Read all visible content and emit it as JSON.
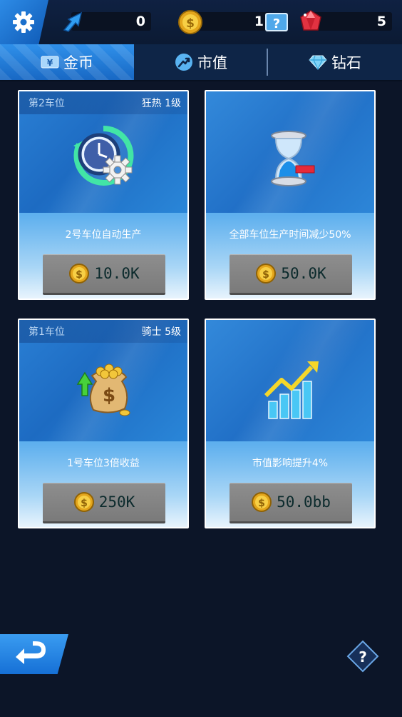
{
  "resources": {
    "shares": "0",
    "coins": "1",
    "gems": "5"
  },
  "tabs": [
    {
      "label": "金币",
      "icon": "coin-ticket-icon",
      "active": true
    },
    {
      "label": "市值",
      "icon": "market-arrow-icon",
      "active": false
    },
    {
      "label": "钻石",
      "icon": "diamond-icon",
      "active": false
    }
  ],
  "cards": [
    {
      "slot": "第2车位",
      "rank": "狂热  1级",
      "desc": "2号车位自动生产",
      "price": "10.0K",
      "icon": "clock-gear-icon"
    },
    {
      "slot": "",
      "rank": "",
      "desc": "全部车位生产时间减少50%",
      "price": "50.0K",
      "icon": "hourglass-icon"
    },
    {
      "slot": "第1车位",
      "rank": "骑士  5级",
      "desc": "1号车位3倍收益",
      "price": "250K",
      "icon": "money-bag-icon"
    },
    {
      "slot": "",
      "rank": "",
      "desc": "市值影响提升4%",
      "price": "50.0bb",
      "icon": "growth-chart-icon"
    }
  ],
  "colors": {
    "background": "#0c1528",
    "tab_active": "#1f7bd8",
    "card_blue": "#2a7fd4",
    "button_gray": "#8a8a8a"
  }
}
